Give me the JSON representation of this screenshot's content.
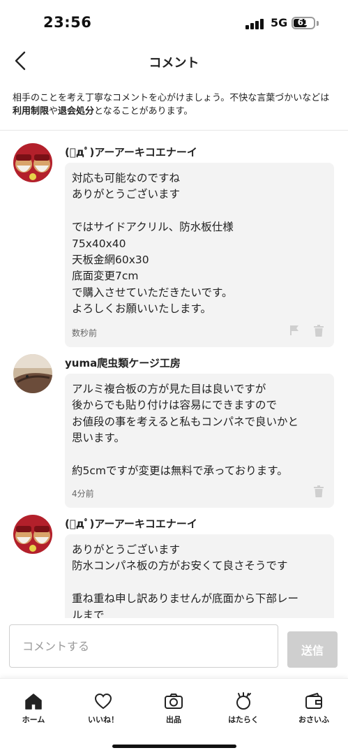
{
  "status": {
    "time": "23:56",
    "network": "5G",
    "battery": "61"
  },
  "header": {
    "title": "コメント"
  },
  "notice": {
    "part1": "相手のことを考え丁寧なコメントを心がけましょう。不快な言葉づかいなどは",
    "bold1": "利用制限",
    "part2": "や",
    "bold2": "退会処分",
    "part3": "となることがあります。"
  },
  "comments": [
    {
      "name": "(ﾟдﾟ)アーアーキコエナーイ",
      "lines": [
        "対応も可能なのですね",
        "ありがとうございます",
        "",
        "ではサイドアクリル、防水板仕様",
        "75x40x40",
        "天板金網60x30",
        "底面変更7cm",
        "で購入させていただきたいです。",
        "よろしくお願いいたします。"
      ],
      "time": "数秒前"
    },
    {
      "name": "yuma爬虫類ケージ工房",
      "lines": [
        "アルミ複合板の方が見た目は良いですが",
        "後からでも貼り付けは容易にできますので",
        "お値段の事を考えると私もコンパネで良いかと",
        "思います。",
        "",
        "約5cmですが変更は無料で承っております。"
      ],
      "time": "4分前"
    },
    {
      "name": "(ﾟдﾟ)アーアーキコエナーイ",
      "lines": [
        "ありがとうございます",
        "防水コンパネ板の方がお安くて良さそうです",
        "",
        "重ね重ね申し訳ありませんが底面から下部レー",
        "ルまで"
      ],
      "time": ""
    }
  ],
  "input": {
    "placeholder": "コメントする",
    "send_label": "送信"
  },
  "tabs": [
    {
      "label": "ホーム",
      "icon": "home-icon"
    },
    {
      "label": "いいね！",
      "icon": "heart-icon"
    },
    {
      "label": "出品",
      "icon": "camera-icon"
    },
    {
      "label": "はたらく",
      "icon": "work-icon"
    },
    {
      "label": "おさいふ",
      "icon": "wallet-icon"
    }
  ]
}
